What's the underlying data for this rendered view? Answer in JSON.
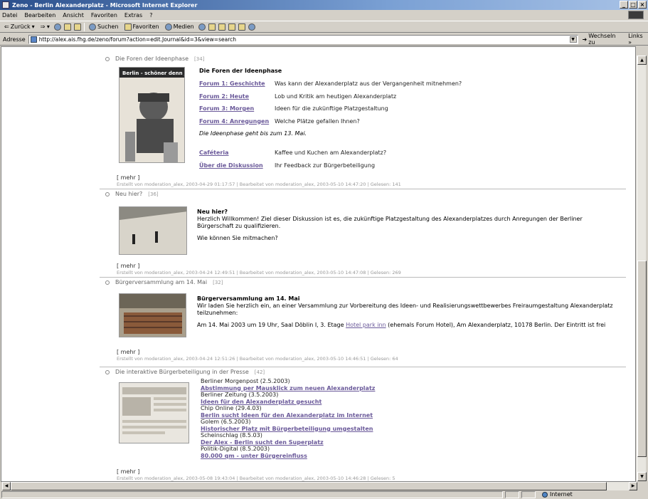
{
  "window": {
    "title": "Zeno - Berlin Alexanderplatz - Microsoft Internet Explorer",
    "buttons": [
      "minimize",
      "maximize",
      "close"
    ]
  },
  "menu": [
    {
      "label": "Datei"
    },
    {
      "label": "Bearbeiten"
    },
    {
      "label": "Ansicht"
    },
    {
      "label": "Favoriten"
    },
    {
      "label": "Extras"
    },
    {
      "label": "?"
    }
  ],
  "toolbar": {
    "back": "Zurück",
    "search": "Suchen",
    "favorites": "Favoriten",
    "media": "Medien"
  },
  "address": {
    "label": "Adresse",
    "url": "http://alex.ais.fhg.de/zeno/forum?action=edit.Journal&id=3&view=search",
    "go": "Wechseln zu",
    "links": "Links »"
  },
  "status": {
    "zone": "Internet"
  },
  "entries": [
    {
      "title": "Die Foren der Ideenphase",
      "count": "[34]",
      "heading": "Die Foren der Ideenphase",
      "forums": [
        {
          "link": "Forum 1: Geschichte",
          "desc": "Was kann der Alexanderplatz aus der Vergangenheit mitnehmen?"
        },
        {
          "link": "Forum 2: Heute",
          "desc": "Lob und Kritik am heutigen Alexanderplatz"
        },
        {
          "link": "Forum 3: Morgen",
          "desc": "Ideen für die zukünftige Platzgestaltung"
        },
        {
          "link": "Forum 4: Anregungen",
          "desc": "Welche Plätze gefallen Ihnen?"
        }
      ],
      "note": "Die Ideenphase geht bis zum 13. Mai.",
      "extras": [
        {
          "link": "Caféteria",
          "desc": "Kaffee und Kuchen am Alexanderplatz?"
        },
        {
          "link": "Über die Diskussion",
          "desc": "Ihr Feedback zur Bürgerbeteiligung"
        }
      ],
      "image_caption": "Berlin - schöner denn je!",
      "more": "[ mehr ]",
      "meta": "Erstellt von moderation_alex, 2003-04-29 01:17:57 | Bearbeitet von moderation_alex, 2003-05-10 14:47:20 | Gelesen: 141"
    },
    {
      "title": "Neu hier?",
      "count": "[36]",
      "heading": "Neu hier?",
      "text1": "Herzlich Willkommen! Ziel dieser Diskussion ist es, die zukünftige Platzgestaltung des Alexanderplatzes durch Anregungen der Berliner Bürgerschaft zu qualifizieren.",
      "text2": "Wie können Sie mitmachen?",
      "more": "[ mehr ]",
      "meta": "Erstellt von moderation_alex, 2003-04-24 12:49:51 | Bearbeitet von moderation_alex, 2003-05-10 14:47:08 | Gelesen: 269"
    },
    {
      "title": "Bürgerversammlung am 14. Mai",
      "count": "[32]",
      "heading": "Bürgerversammlung am 14. Mai",
      "text1": "Wir laden Sie herzlich ein, an einer Versammlung zur Vorbereitung des Ideen- und Realisierungswettbewerbes Freiraumgestaltung Alexanderplatz teilzunehmen:",
      "text2a": "Am 14. Mai 2003 um 19 Uhr, Saal Döblin I, 3. Etage ",
      "text2link": "Hotel park inn",
      "text2b": " (ehemals Forum Hotel), Am Alexanderplatz, 10178 Berlin. Der Eintritt ist frei",
      "more": "[ mehr ]",
      "meta": "Erstellt von moderation_alex, 2003-04-24 12:51:26 | Bearbeitet von moderation_alex, 2003-05-10 14:46:51 | Gelesen: 64"
    },
    {
      "title": "Die interaktive Bürgerbeteiligung in der Presse",
      "count": "[42]",
      "press": [
        {
          "source": "Berliner Morgenpost (2.5.2003)",
          "link": "Abstimmung per Mausklick zum neuen Alexanderplatz"
        },
        {
          "source": "Berliner Zeitung (3.5.2003)",
          "link": "Ideen für den Alexanderplatz gesucht"
        },
        {
          "source": "Chip Online (29.4.03)",
          "link": "Berlin sucht Ideen für den Alexanderplatz im Internet"
        },
        {
          "source": "Golem (6.5.2003)",
          "link": "Historischer Platz mit Bürgerbeteiligung umgestalten"
        },
        {
          "source": "Scheinschlag (8.5.03)",
          "link": "Der Alex - Berlin sucht den Superplatz"
        },
        {
          "source": "Politik-Digital (8.5.2003)",
          "link": "80.000 qm - unter Bürgereinfluss"
        }
      ],
      "more": "[ mehr ]",
      "meta": "Erstellt von moderation_alex, 2003-05-08 19:43:04 | Bearbeitet von moderation_alex, 2003-05-10 14:46:28 | Gelesen: 5"
    }
  ]
}
